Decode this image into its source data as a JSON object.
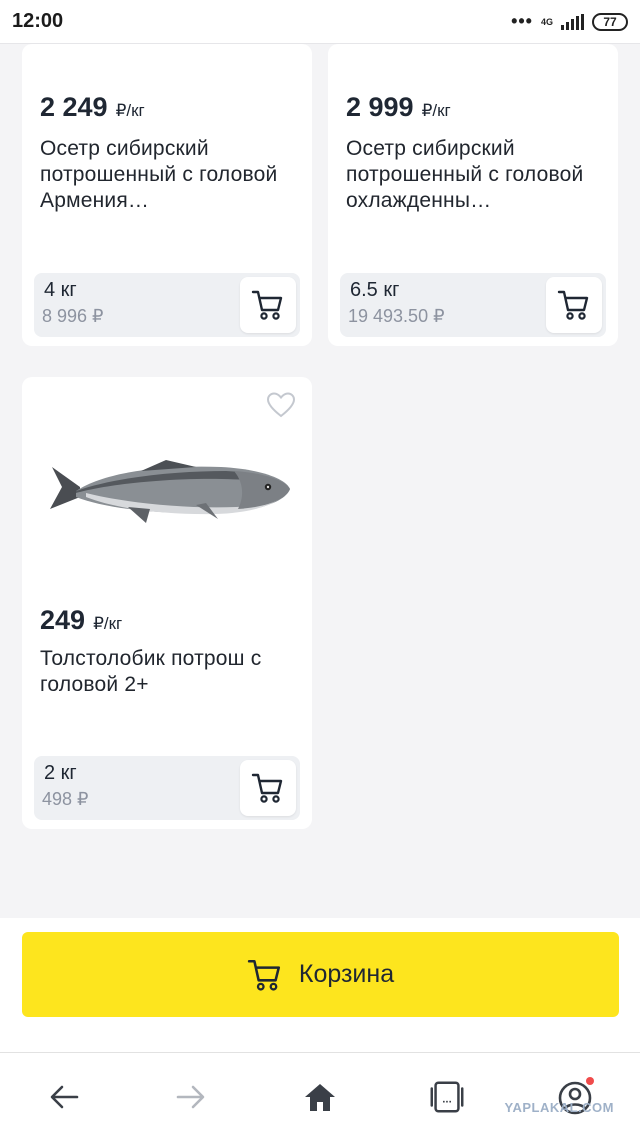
{
  "status_bar": {
    "time": "12:00",
    "dots": "•••",
    "network": "4G",
    "battery": "77"
  },
  "products": [
    {
      "price": "2 249",
      "unit": "₽/кг",
      "title": "Осетр сибирский потрошенный с головой Армения…",
      "quantity": "4 кг",
      "sum": "8 996 ₽"
    },
    {
      "price": "2 999",
      "unit": "₽/кг",
      "title": "Осетр сибирский потрошенный с головой охлажденны…",
      "quantity": "6.5 кг",
      "sum": "19 493.50 ₽"
    },
    {
      "price": "249",
      "unit": "₽/кг",
      "title": "Толстолобик потрош с головой 2+",
      "quantity": "2 кг",
      "sum": "498 ₽",
      "image": "fish-image"
    }
  ],
  "basket": {
    "label": "Корзина",
    "color": "#fde51e"
  },
  "browser_nav": {
    "icons": [
      "back-arrow-icon",
      "forward-arrow-icon",
      "home-icon",
      "tabs-icon",
      "profile-icon"
    ],
    "tabs_text": "..."
  },
  "watermark": "YAPLAKAL.COM",
  "colors": {
    "accent_yellow": "#fde51e",
    "notification_dot": "#f04b4b",
    "background": "#f4f4f6"
  }
}
